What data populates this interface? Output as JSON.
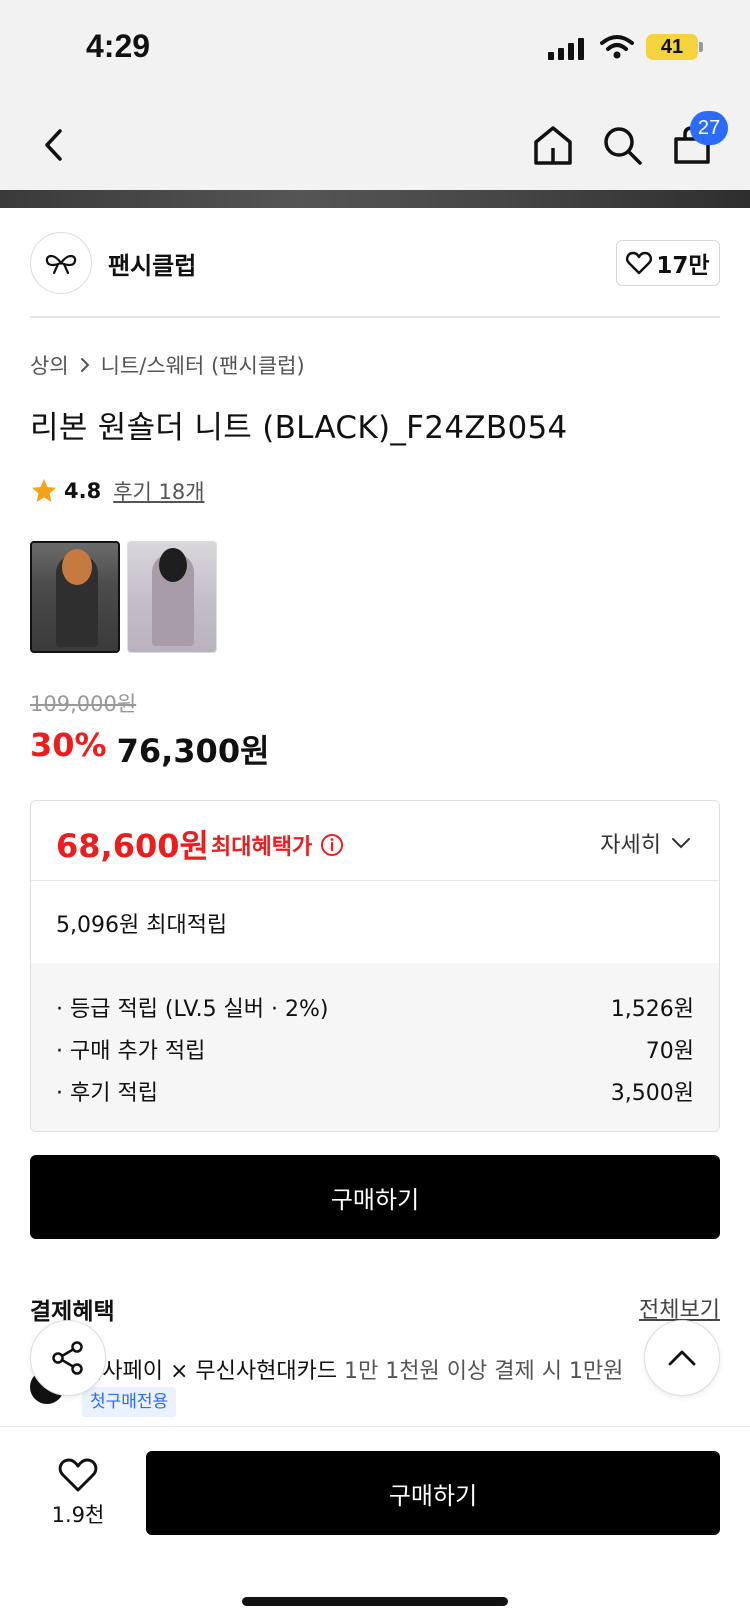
{
  "status": {
    "time": "4:29",
    "battery": "41"
  },
  "nav": {
    "cart_count": "27"
  },
  "brand": {
    "name": "팬시클럽",
    "likes": "17만"
  },
  "breadcrumb": {
    "category": "상의",
    "subcategory": "니트/스웨터 (팬시클럽)"
  },
  "product": {
    "title": "리본 원숄더 니트 (BLACK)_F24ZB054",
    "rating": "4.8",
    "review_text": "후기 18개",
    "original_price": "109,000원",
    "discount_rate": "30%",
    "sale_price": "76,300원"
  },
  "benefit": {
    "max_price": "68,600원",
    "max_label": "최대혜택가",
    "detail_label": "자세히",
    "points_total": "5,096원 최대적립",
    "points": [
      {
        "label": "· 등급 적립 (LV.5 실버 · 2%)",
        "value": "1,526원"
      },
      {
        "label": "· 구매 추가 적립",
        "value": "70원"
      },
      {
        "label": "· 후기 적립",
        "value": "3,500원"
      }
    ]
  },
  "buy_label": "구매하기",
  "payment": {
    "title": "결제혜택",
    "view_all": "전체보기",
    "promo_main": "신사페이 × 무신사현대카드",
    "promo_sub": " 1만 1천원 이상 결제 시 1만원",
    "badge": "첫구매전용"
  },
  "bottom": {
    "wish_count": "1.9천",
    "buy_label": "구매하기"
  },
  "colors": {
    "sale_red": "#ee1d1d",
    "badge_blue": "#2b6bff",
    "star": "#f7a21b"
  }
}
